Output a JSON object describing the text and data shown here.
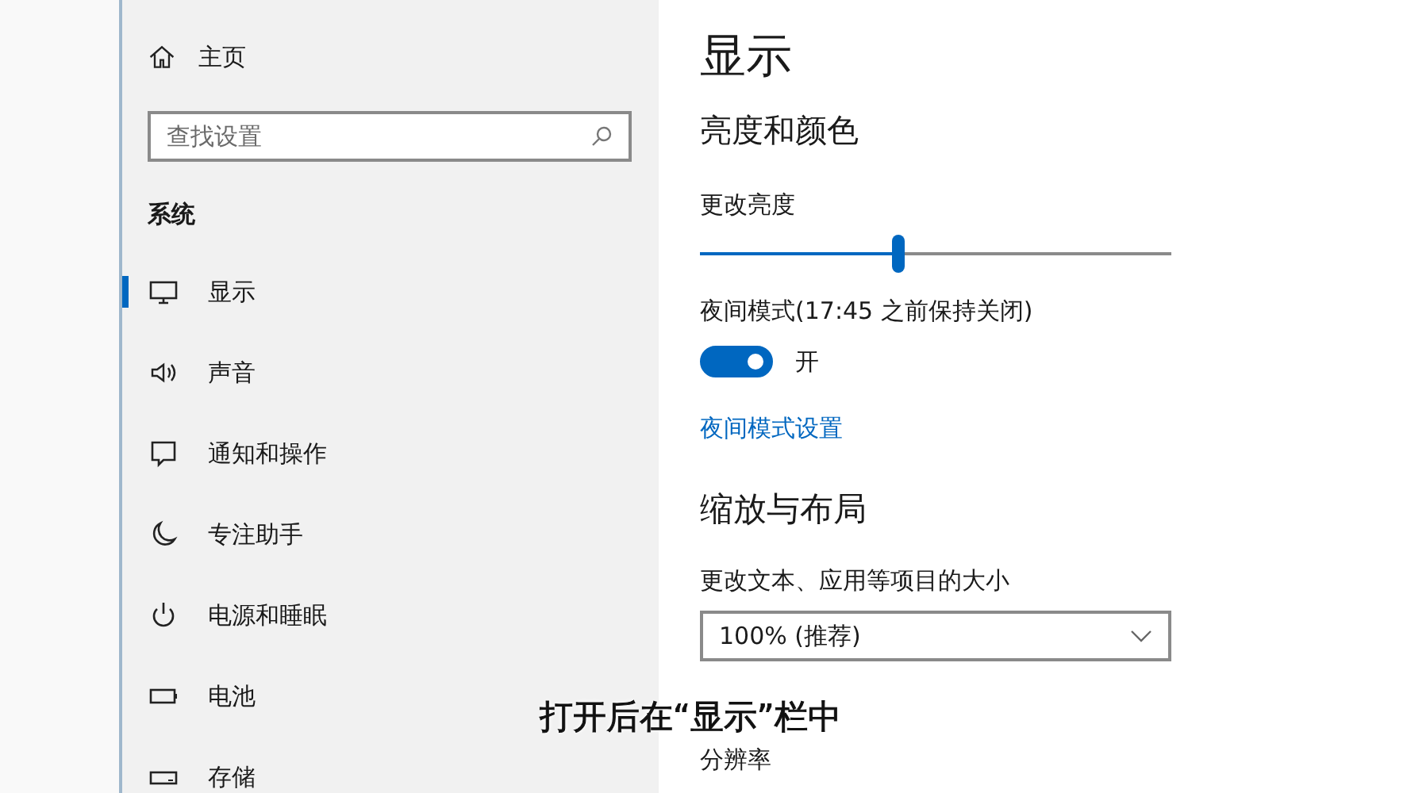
{
  "sidebar": {
    "home": {
      "label": "主页"
    },
    "search": {
      "placeholder": "查找设置"
    },
    "section": "系统",
    "items": [
      {
        "label": "显示",
        "selected": true
      },
      {
        "label": "声音",
        "selected": false
      },
      {
        "label": "通知和操作",
        "selected": false
      },
      {
        "label": "专注助手",
        "selected": false
      },
      {
        "label": "电源和睡眠",
        "selected": false
      },
      {
        "label": "电池",
        "selected": false
      },
      {
        "label": "存储",
        "selected": false
      }
    ]
  },
  "content": {
    "title": "显示",
    "brightness_heading": "亮度和颜色",
    "brightness_label": "更改亮度",
    "brightness": {
      "level": 0.42
    },
    "night_label": "夜间模式(17:45 之前保持关闭)",
    "night_toggle": {
      "on": true,
      "label": "开"
    },
    "night_link": "夜间模式设置",
    "scale_heading": "缩放与布局",
    "scale_label": "更改文本、应用等项目的大小",
    "scale_value": "100% (推荐)",
    "resolution_label": "分辨率"
  },
  "caption": "打开后在“显示”栏中"
}
